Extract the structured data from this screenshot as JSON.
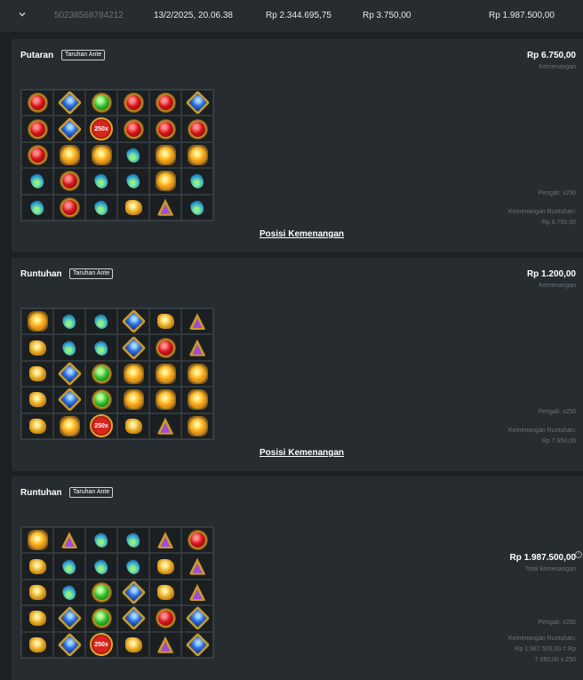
{
  "top_row": {
    "round_id": "50238568784212",
    "datetime": "13/2/2025, 20.06.38",
    "balance": "Rp 2.344.695,75",
    "bet": "Rp 3.750,00",
    "win": "Rp 1.987.500,00"
  },
  "panels": [
    {
      "title": "Putaran",
      "badge": "Taruhan Ante",
      "amount": "Rp 6.750,00",
      "amount_label": "Kemenangan",
      "multiplier": "Pengali: x250",
      "cascade_label": "Kemenangan Runtuhan:",
      "cascade_value": "Rp 6.750,00",
      "link": "Posisi Kemenangan",
      "grid": [
        [
          "red",
          "blue",
          "green",
          "red",
          "red",
          "blue"
        ],
        [
          "red",
          "blue",
          "scatter",
          "red",
          "red",
          "red"
        ],
        [
          "red",
          "orange",
          "orange",
          "potion",
          "orange",
          "orange"
        ],
        [
          "potion",
          "red",
          "potion",
          "potion",
          "orange",
          "potion"
        ],
        [
          "potion",
          "red",
          "potion",
          "gold",
          "purple",
          "potion"
        ]
      ]
    },
    {
      "title": "Runtuhan",
      "badge": "Taruhan Ante",
      "amount": "Rp 1.200,00",
      "amount_label": "Kemenangan",
      "multiplier": "Pengali: x250",
      "cascade_label": "Kemenangan Runtuhan:",
      "cascade_value": "Rp 7.950,00",
      "link": "Posisi Kemenangan",
      "grid": [
        [
          "orange",
          "potion",
          "potion",
          "blue",
          "gold",
          "purple"
        ],
        [
          "gold",
          "potion",
          "potion",
          "blue",
          "red",
          "purple"
        ],
        [
          "gold",
          "blue",
          "green",
          "orange",
          "orange",
          "orange"
        ],
        [
          "gold",
          "blue",
          "green",
          "orange",
          "orange",
          "orange"
        ],
        [
          "gold",
          "orange",
          "scatter",
          "gold",
          "purple",
          "orange"
        ]
      ]
    },
    {
      "title": "Runtuhan",
      "badge": "Taruhan Ante",
      "total_amount": "Rp 1.987.500,00",
      "total_label": "Total kemenangan",
      "multiplier": "Pengali: x250",
      "cascade_label": "Kemenangan Runtuhan:",
      "cascade_value_line1": "Rp 1.987.500,00 = Rp",
      "cascade_value_line2": "7.950,00 x 250",
      "grid": [
        [
          "orange",
          "purple",
          "potion",
          "potion",
          "purple",
          "red"
        ],
        [
          "gold",
          "potion",
          "potion",
          "potion",
          "gold",
          "purple"
        ],
        [
          "gold",
          "potion",
          "green",
          "blue",
          "gold",
          "purple"
        ],
        [
          "gold",
          "blue",
          "green",
          "blue",
          "red",
          "blue"
        ],
        [
          "gold",
          "blue",
          "scatter",
          "gold",
          "purple",
          "blue"
        ]
      ]
    }
  ],
  "scatter_label": "250x",
  "icons": {
    "expand": "chevron-down-icon",
    "info": "info-icon",
    "symbols": [
      "red-gem",
      "blue-gem",
      "green-gem",
      "orange-gem",
      "purple-gem",
      "potion",
      "gold-idol",
      "scatter-multiplier"
    ]
  },
  "colors": {
    "background": "#1c2124",
    "panel": "#262c30",
    "muted_text": "#6b7378"
  }
}
